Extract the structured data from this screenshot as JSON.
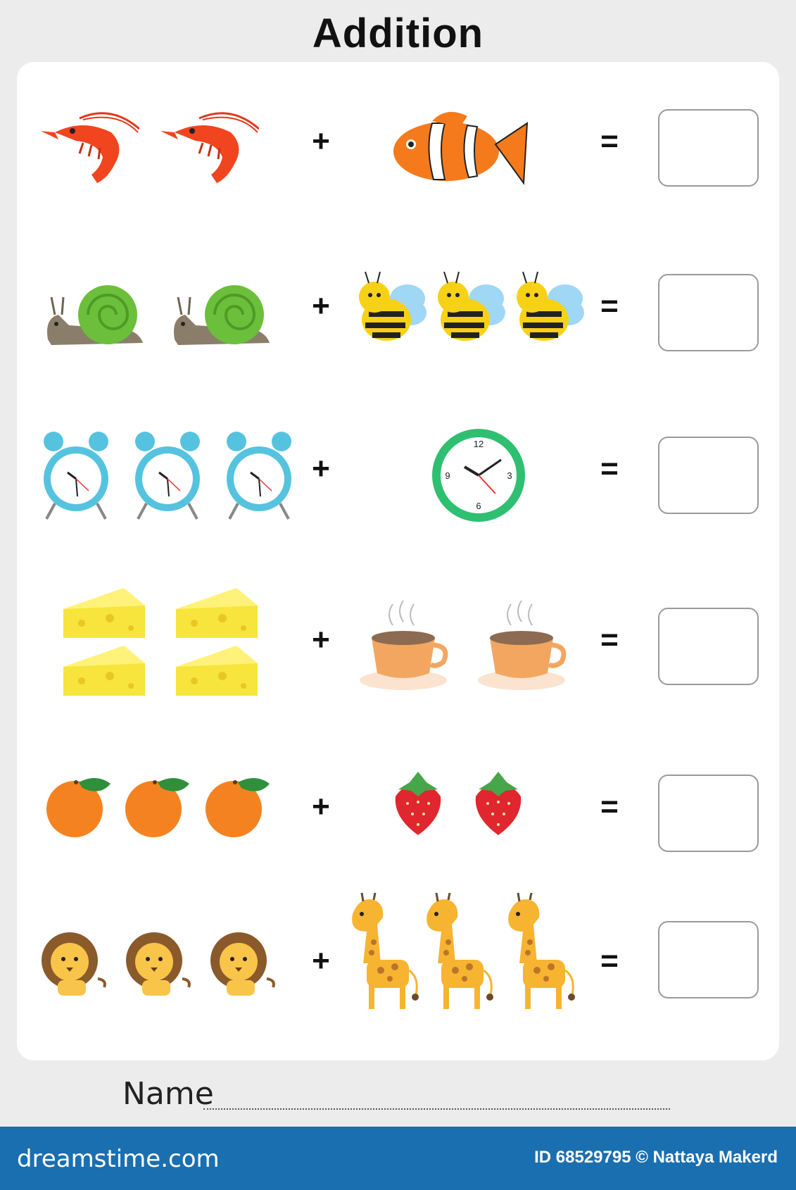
{
  "title": "Addition",
  "rows": [
    {
      "left": {
        "item": "shrimp-icon",
        "count": 2
      },
      "right": {
        "item": "clownfish-icon",
        "count": 1
      },
      "plus": "+",
      "equals": "="
    },
    {
      "left": {
        "item": "snail-icon",
        "count": 2
      },
      "right": {
        "item": "bee-icon",
        "count": 3
      },
      "plus": "+",
      "equals": "="
    },
    {
      "left": {
        "item": "alarm-clock-icon",
        "count": 3
      },
      "right": {
        "item": "wall-clock-icon",
        "count": 1
      },
      "plus": "+",
      "equals": "="
    },
    {
      "left": {
        "item": "cheese-icon",
        "count": 4
      },
      "right": {
        "item": "coffee-cup-icon",
        "count": 2
      },
      "plus": "+",
      "equals": "="
    },
    {
      "left": {
        "item": "orange-icon",
        "count": 3
      },
      "right": {
        "item": "strawberry-icon",
        "count": 2
      },
      "plus": "+",
      "equals": "="
    },
    {
      "left": {
        "item": "lion-icon",
        "count": 3
      },
      "right": {
        "item": "giraffe-icon",
        "count": 3
      },
      "plus": "+",
      "equals": "="
    }
  ],
  "clock_numbers": [
    "12",
    "3",
    "6",
    "9"
  ],
  "name_label": "Name",
  "footer": {
    "brand": "dreamstime.com",
    "credit": "ID 68529795 © Nattaya Makerd"
  },
  "colors": {
    "footer": "#1a6fb0",
    "background": "#ececec",
    "card": "#ffffff"
  }
}
